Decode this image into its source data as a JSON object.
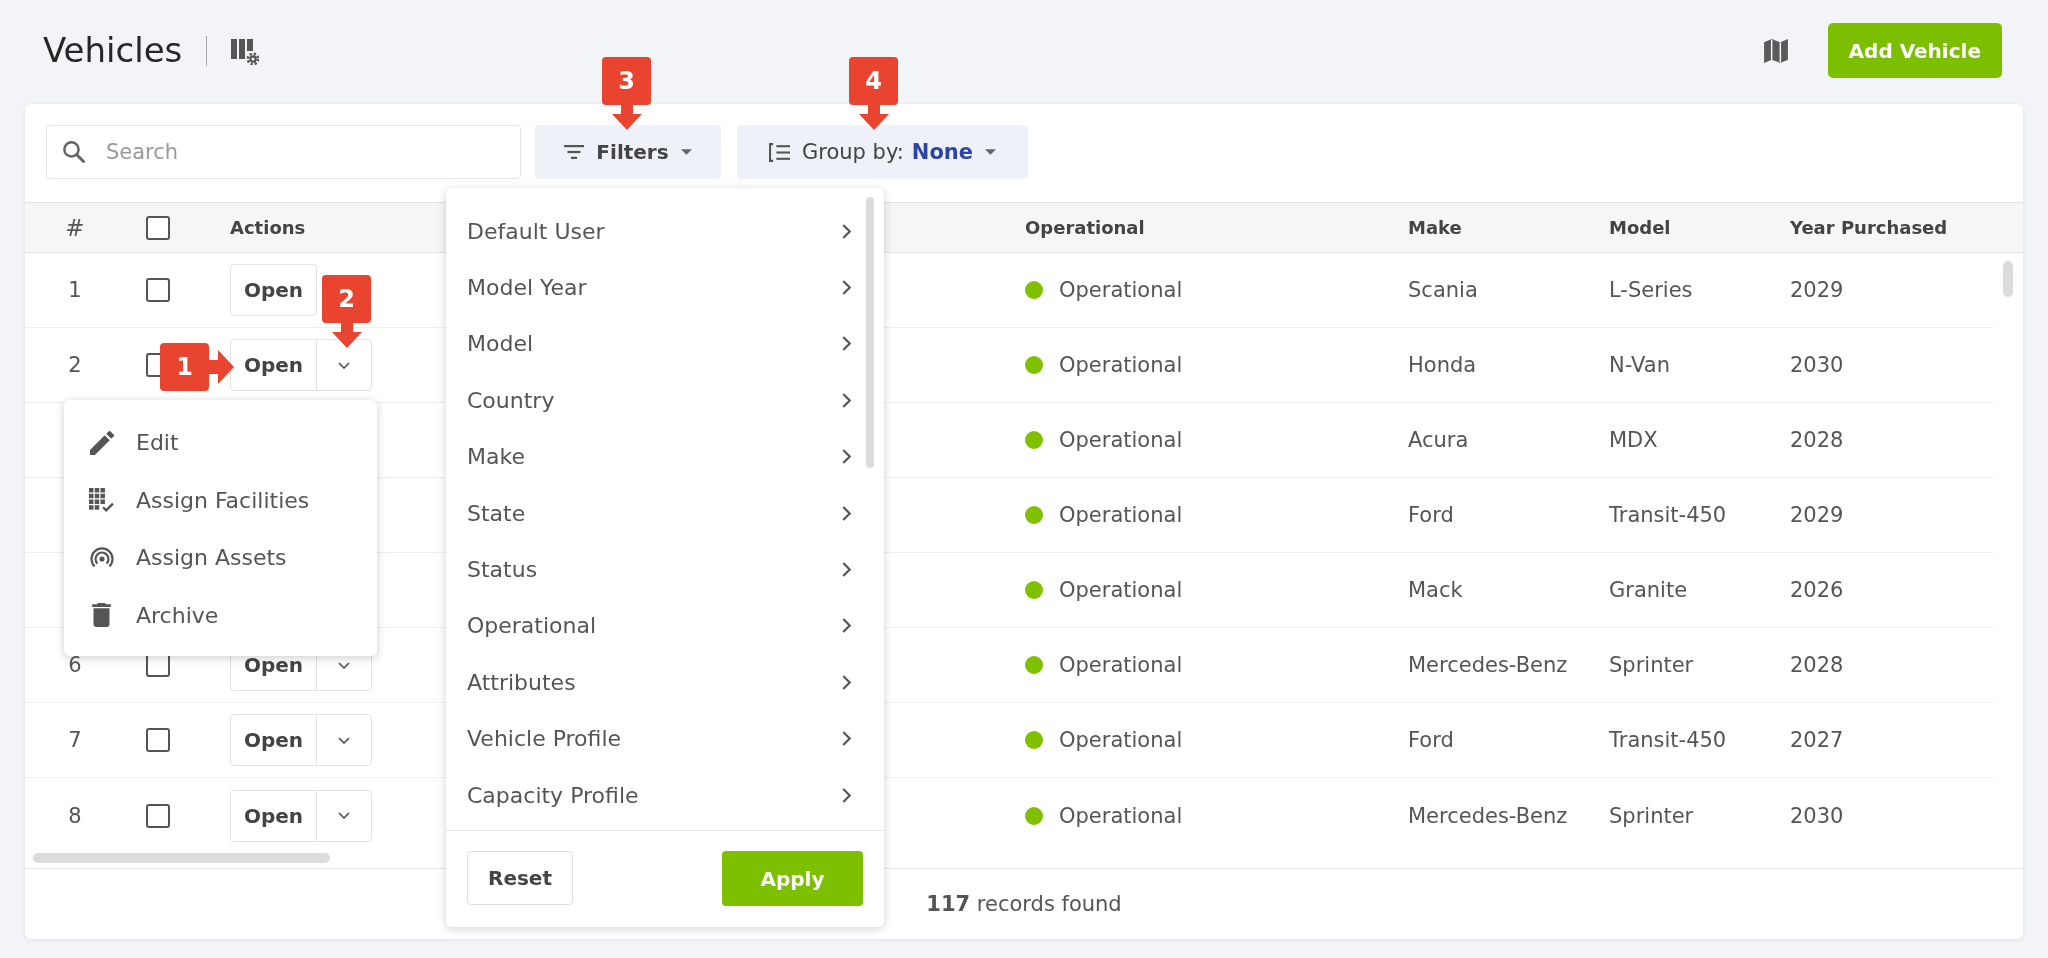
{
  "header": {
    "title": "Vehicles",
    "add_button": "Add Vehicle"
  },
  "toolbar": {
    "search": {
      "placeholder": "Search"
    },
    "filters": {
      "label": "Filters"
    },
    "group_by": {
      "label": "Group by:",
      "value": "None"
    }
  },
  "table": {
    "columns": [
      {
        "kind": "text",
        "label": "#"
      },
      {
        "kind": "checkbox",
        "checked": false
      },
      {
        "kind": "text",
        "label": "Actions"
      },
      {
        "kind": "text",
        "label": "Operational"
      },
      {
        "kind": "text",
        "label": "Make"
      },
      {
        "kind": "text",
        "label": "Model"
      },
      {
        "kind": "text",
        "label": "Year Purchased"
      }
    ],
    "rows": [
      {
        "number": "1",
        "checked": false,
        "action": {
          "label": "Open",
          "dropdown": false
        },
        "status": {
          "label": "Operational",
          "color": "#7fc000"
        },
        "make": "Scania",
        "model": "L-Series",
        "year": "2029"
      },
      {
        "number": "2",
        "checked": false,
        "action": {
          "label": "Open",
          "dropdown": true
        },
        "status": {
          "label": "Operational",
          "color": "#7fc000"
        },
        "make": "Honda",
        "model": "N-Van",
        "year": "2030"
      },
      {
        "status": {
          "label": "Operational",
          "color": "#7fc000"
        },
        "make": "Acura",
        "model": "MDX",
        "year": "2028"
      },
      {
        "status": {
          "label": "Operational",
          "color": "#7fc000"
        },
        "make": "Ford",
        "model": "Transit-450",
        "year": "2029"
      },
      {
        "status": {
          "label": "Operational",
          "color": "#7fc000"
        },
        "make": "Mack",
        "model": "Granite",
        "year": "2026"
      },
      {
        "number": "6",
        "checked": false,
        "action": {
          "label": "Open",
          "dropdown": true
        },
        "status": {
          "label": "Operational",
          "color": "#7fc000"
        },
        "make": "Mercedes-Benz",
        "model": "Sprinter",
        "year": "2028"
      },
      {
        "number": "7",
        "checked": false,
        "action": {
          "label": "Open",
          "dropdown": true
        },
        "status": {
          "label": "Operational",
          "color": "#7fc000"
        },
        "make": "Ford",
        "model": "Transit-450",
        "year": "2027"
      },
      {
        "number": "8",
        "checked": false,
        "action": {
          "label": "Open",
          "dropdown": true
        },
        "status": {
          "label": "Operational",
          "color": "#7fc000"
        },
        "make": "Mercedes-Benz",
        "model": "Sprinter",
        "year": "2030"
      }
    ],
    "footer": "**117** records found"
  },
  "row_menu": {
    "items": [
      {
        "label": "Edit"
      },
      {
        "label": "Assign Facilities"
      },
      {
        "label": "Assign Assets"
      },
      {
        "label": "Archive"
      }
    ]
  },
  "filters_menu": {
    "items": [
      {
        "label": "Default User"
      },
      {
        "label": "Model Year"
      },
      {
        "label": "Model"
      },
      {
        "label": "Country"
      },
      {
        "label": "Make"
      },
      {
        "label": "State"
      },
      {
        "label": "Status"
      },
      {
        "label": "Operational"
      },
      {
        "label": "Attributes"
      },
      {
        "label": "Vehicle Profile"
      },
      {
        "label": "Capacity Profile"
      }
    ],
    "reset": "Reset",
    "apply": "Apply"
  },
  "callouts": [
    {
      "label": "1",
      "kind": "right"
    },
    {
      "label": "2",
      "kind": "down"
    },
    {
      "label": "3",
      "kind": "down"
    },
    {
      "label": "4",
      "kind": "down"
    }
  ]
}
